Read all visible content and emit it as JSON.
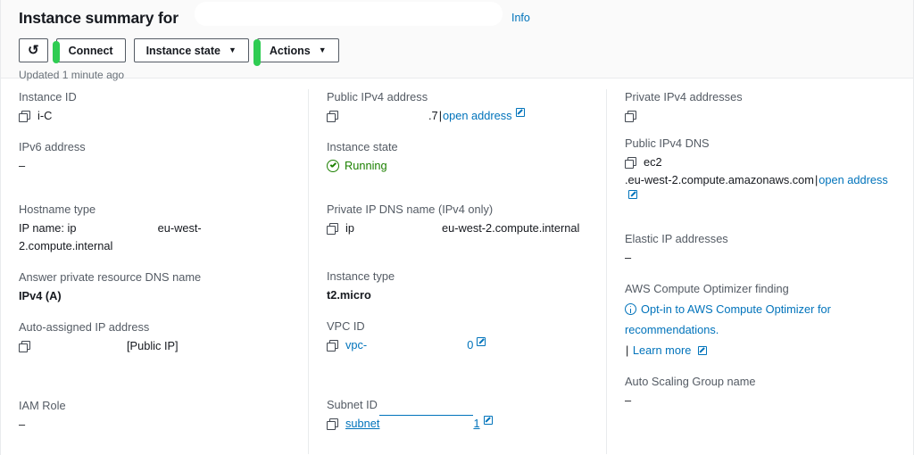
{
  "header": {
    "title": "Instance summary for",
    "info_label": "Info",
    "refresh_icon": "refresh-icon",
    "connect_label": "Connect",
    "instance_state_label": "Instance state",
    "actions_label": "Actions",
    "caret_glyph": "▼",
    "updated_text": "Updated 1 minute ago",
    "marker_color": "#2ecc52",
    "link_color": "#0073bb",
    "running_color": "#1d8102"
  },
  "columns": {
    "col1": [
      {
        "label": "Instance ID",
        "value": "i-C",
        "copy": true
      },
      {
        "label": "IPv6 address",
        "value": "–",
        "copy": false
      },
      {
        "label": "Hostname type",
        "value_prefix": "IP name: ip",
        "value_suffix": "eu-west-2.compute.internal",
        "copy": false
      },
      {
        "label": "Answer private resource DNS name",
        "value": "IPv4 (A)",
        "copy": false,
        "bold": true
      },
      {
        "label": "Auto-assigned IP address",
        "value": "[Public IP]",
        "copy": true
      },
      {
        "label": "IAM Role",
        "value": "–",
        "copy": false
      }
    ],
    "col2": [
      {
        "label": "Public IPv4 address",
        "value": ".7",
        "copy": true,
        "link": "open address"
      },
      {
        "label": "Instance state",
        "value": "Running",
        "status": true
      },
      {
        "label": "Private IP DNS name (IPv4 only)",
        "value_prefix": "ip",
        "value_suffix": "eu-west-2.compute.internal",
        "copy": true
      },
      {
        "label": "Instance type",
        "value": "t2.micro",
        "bold": true
      },
      {
        "label": "VPC ID",
        "value": "vpc-",
        "copy": true,
        "link_value": "0"
      },
      {
        "label": "Subnet ID",
        "value": "subnet",
        "copy": true,
        "link_value": "1"
      }
    ],
    "col3": [
      {
        "label": "Private IPv4 addresses",
        "value": "",
        "copy": true
      },
      {
        "label": "Public IPv4 DNS",
        "value_prefix": "ec2",
        "value_suffix": ".eu-west-2.compute.amazonaws.com",
        "copy": true,
        "link": "open address"
      },
      {
        "label": "Elastic IP addresses",
        "value": "–"
      },
      {
        "label": "AWS Compute Optimizer finding",
        "optimizer_text": "Opt-in to AWS Compute Optimizer for recommendations.",
        "learn_more": "Learn more"
      },
      {
        "label": "Auto Scaling Group name",
        "value": "–"
      }
    ]
  }
}
